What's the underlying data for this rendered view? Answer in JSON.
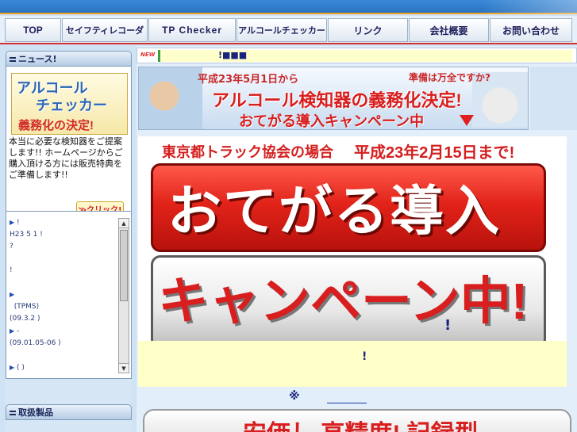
{
  "nav": {
    "items": [
      {
        "label": "TOP"
      },
      {
        "label": "セイフティレコーダ"
      },
      {
        "label": "TP Checker"
      },
      {
        "label": "アルコールチェッカー"
      },
      {
        "label": "リンク"
      },
      {
        "label": "会社概要"
      },
      {
        "label": "お問い合わせ"
      }
    ]
  },
  "sidebar": {
    "news_title": "ニュース!",
    "banner": {
      "line1": "アルコール",
      "line2": "チェッカー",
      "line3": "義務化の決定!"
    },
    "news_text": "本当に必要な検知器をご提案します!! ホームページからご購入頂ける方には販売特典をご準備します!!",
    "click_label": "≫クリック!",
    "news_list": [
      {
        "bullet": "▶",
        "text": "!"
      },
      {
        "bullet": "",
        "text": "H23 5 1            !"
      },
      {
        "bullet": "",
        "text": "       ?"
      },
      {
        "bullet": "",
        "text": "            !"
      },
      {
        "bullet": "▶",
        "text": ""
      },
      {
        "bullet": "",
        "text": "(TPMS)"
      },
      {
        "bullet": "",
        "text": "(09.3.2    )"
      },
      {
        "bullet": "▶",
        "text": "        -"
      },
      {
        "bullet": "",
        "text": "(09.01.05-06   )"
      },
      {
        "bullet": "▶",
        "text": "         (   )"
      }
    ],
    "products_title": "取扱製品"
  },
  "main": {
    "new_tag": "NEW",
    "new_text": "!■■■",
    "hero": {
      "line1a": "平成23年5月1日から",
      "line1b": "準備は万全ですか?",
      "line2": "アルコール検知器の義務化決定!",
      "line3": "おてがる導入キャンペーン中"
    },
    "campaign": {
      "top_left": "東京都トラック協会の場合",
      "top_right": "平成23年2月15日まで!",
      "red_text": "おてがる導入",
      "white_text": "キャンペーン中!"
    },
    "excl1": "!",
    "excl2": "!",
    "kome": "※",
    "bottom_text": "安価し 高精度! 記録型"
  }
}
